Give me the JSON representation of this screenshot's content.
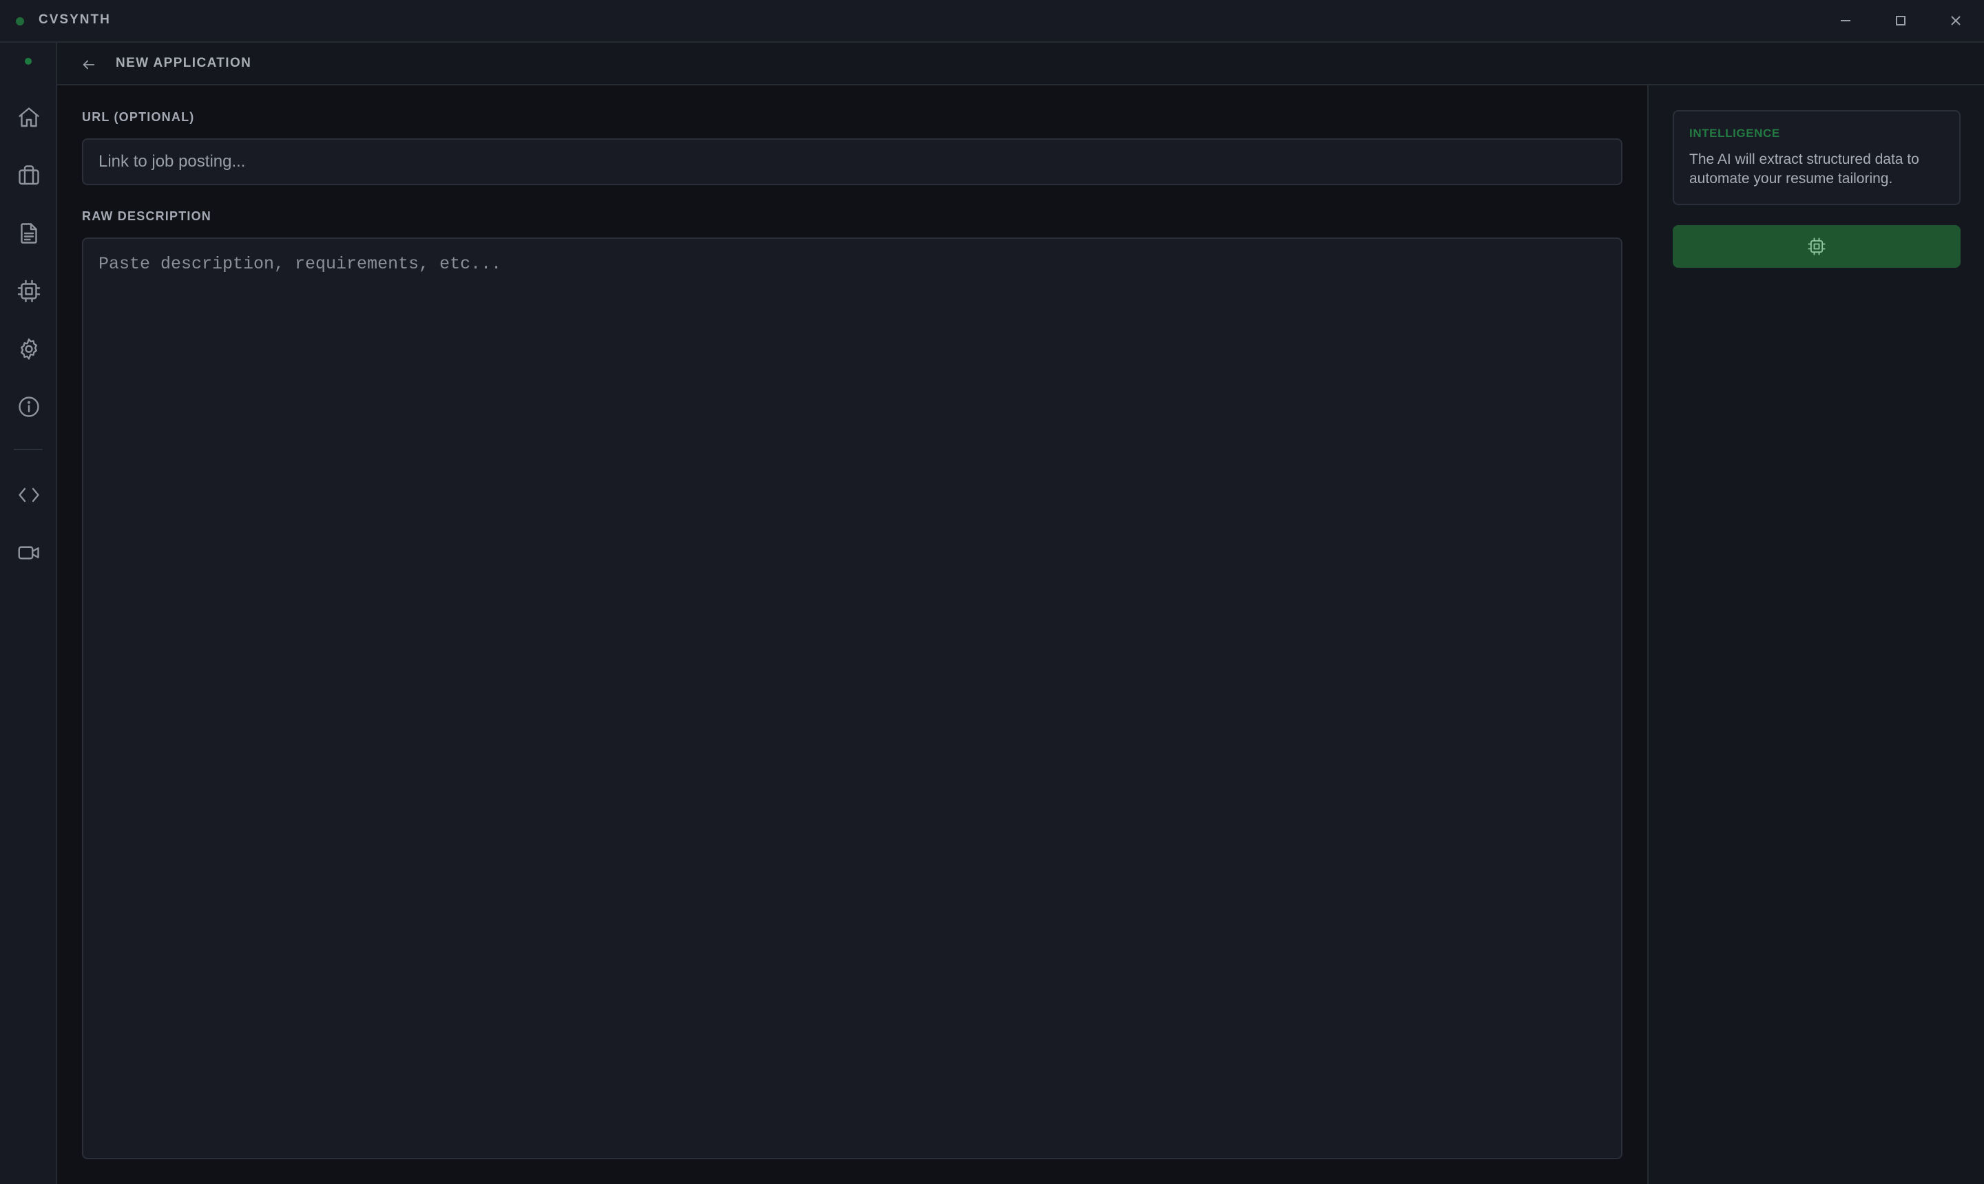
{
  "window": {
    "app_name": "CVSYNTH",
    "controls": [
      "minimize-icon",
      "maximize-icon",
      "close-icon"
    ]
  },
  "sidebar": {
    "items": [
      {
        "icon": "home-icon"
      },
      {
        "icon": "briefcase-icon"
      },
      {
        "icon": "document-icon"
      },
      {
        "icon": "chip-icon"
      },
      {
        "icon": "gear-icon"
      },
      {
        "icon": "info-icon"
      },
      {
        "icon": "code-icon"
      },
      {
        "icon": "video-icon"
      }
    ]
  },
  "header": {
    "back_icon": "arrow-left-icon",
    "title": "NEW APPLICATION"
  },
  "form": {
    "url_label": "URL (OPTIONAL)",
    "url_placeholder": "Link to job posting...",
    "url_value": "",
    "description_label": "RAW DESCRIPTION",
    "description_placeholder": "Paste description, requirements, etc...",
    "description_value": ""
  },
  "side_panel": {
    "card_title": "INTELLIGENCE",
    "card_text": "The AI will extract structured data to automate your resume tailoring.",
    "action_icon": "chip-icon"
  },
  "colors": {
    "accent_green": "#237a42",
    "button_green": "#1f5630",
    "background": "#0f1116"
  }
}
